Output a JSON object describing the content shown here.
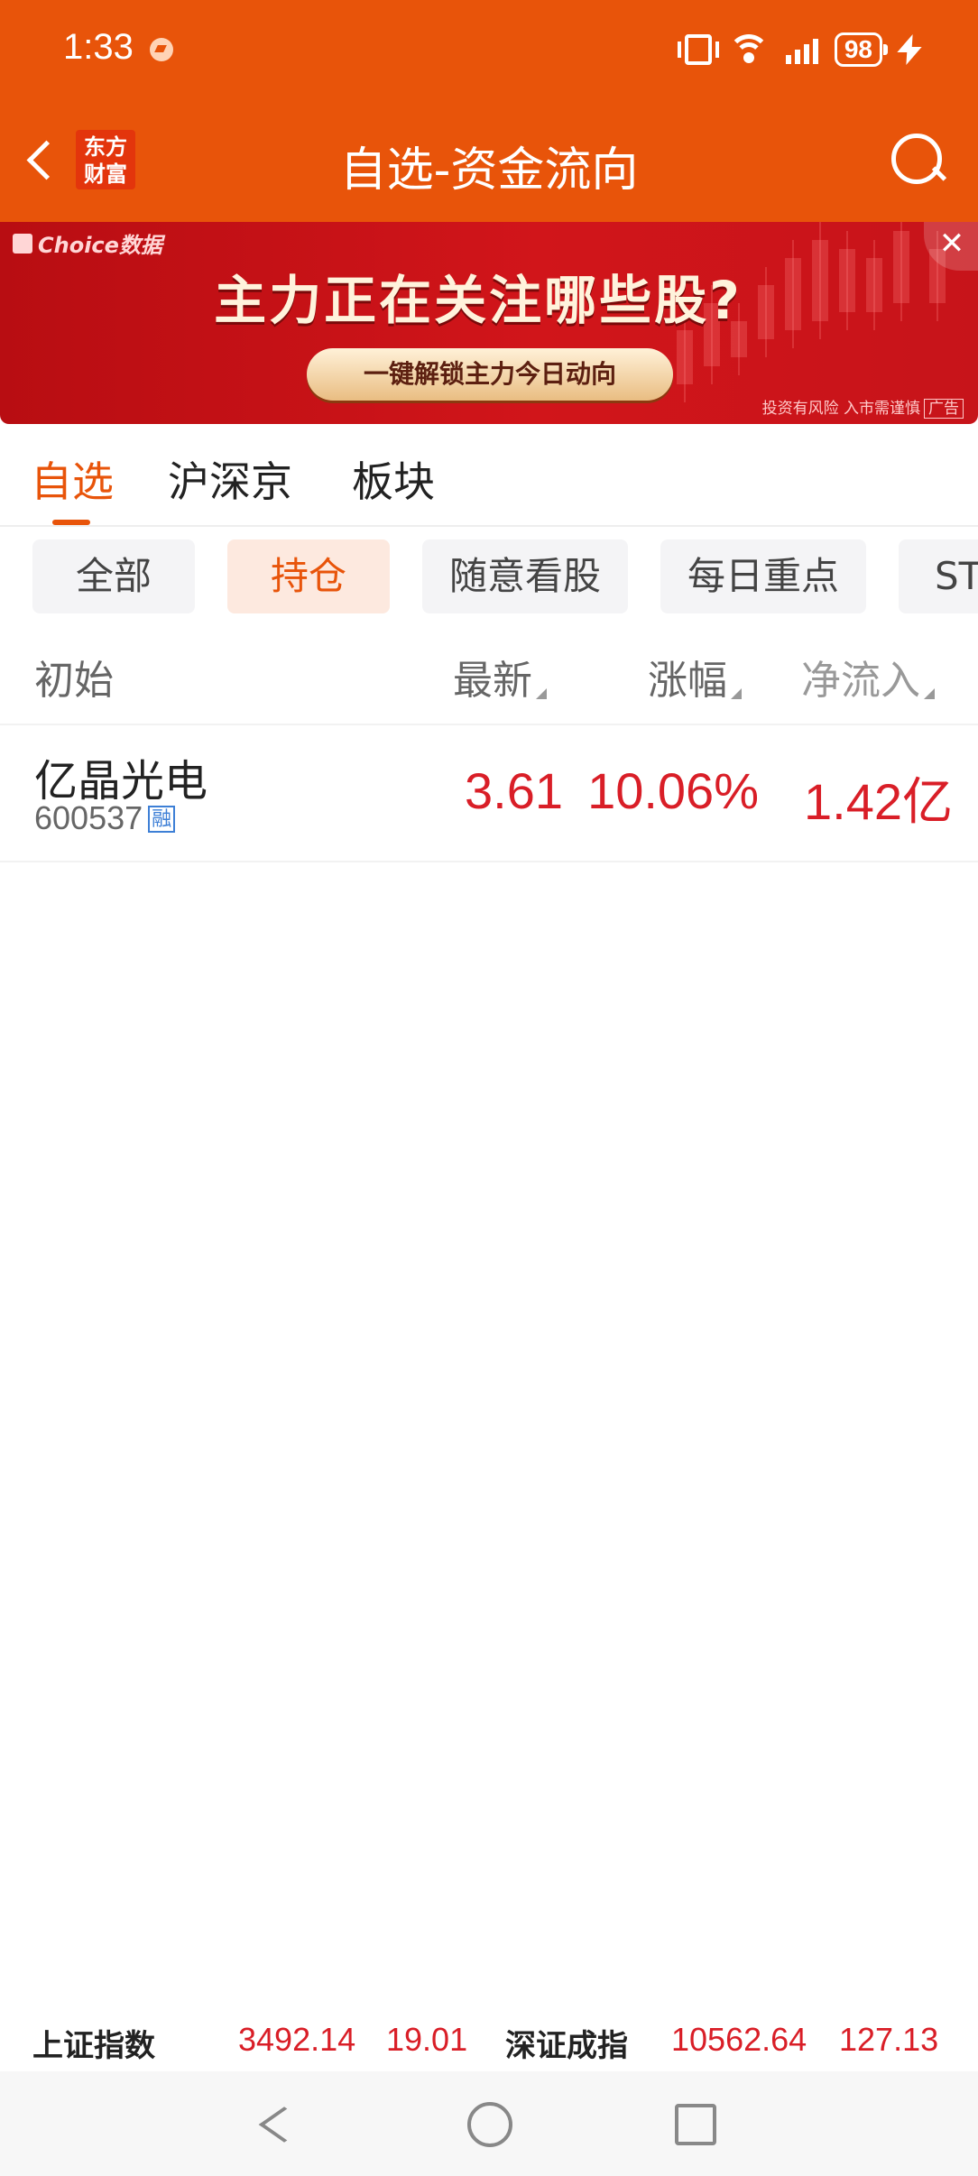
{
  "status": {
    "time": "1:33",
    "battery": "98"
  },
  "header": {
    "title": "自选-资金流向",
    "logo_line1": "东方",
    "logo_line2": "财富"
  },
  "banner": {
    "brand": "Choice数据",
    "headline": "主力正在关注哪些股?",
    "cta": "一键解锁主力今日动向",
    "risk": "投资有风险 入市需谨慎",
    "ad_label": "广告",
    "close": "✕"
  },
  "tabs": [
    "自选",
    "沪深京",
    "板块"
  ],
  "chips": [
    "全部",
    "持仓",
    "随意看股",
    "每日重点",
    "ST"
  ],
  "table": {
    "headers": {
      "name": "初始",
      "latest": "最新",
      "change": "涨幅",
      "netflow": "净流入"
    },
    "rows": [
      {
        "name": "亿晶光电",
        "code": "600537",
        "badge": "融",
        "latest": "3.61",
        "change": "10.06%",
        "netflow": "1.42亿"
      }
    ]
  },
  "ticker": {
    "sh_label": "上证指数",
    "sh_value": "3492.14",
    "sh_change": "19.01",
    "sz_label": "深证成指",
    "sz_value": "10562.64",
    "sz_change": "127.13"
  },
  "colors": {
    "brand": "#e8540a",
    "up": "#d91e27",
    "banner": "#c7141a"
  }
}
